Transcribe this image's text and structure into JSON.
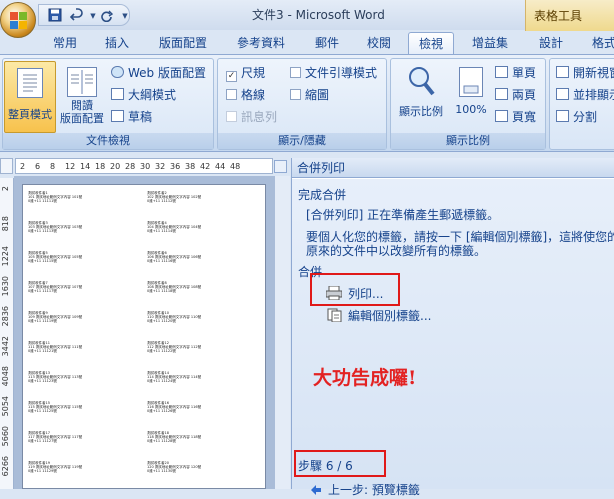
{
  "window": {
    "title": "文件3 - Microsoft Word",
    "context_tab_title": "表格工具"
  },
  "quick_access": {
    "save_icon": "save-icon",
    "undo_icon": "undo-icon",
    "redo_icon": "redo-icon",
    "more": "▼"
  },
  "tabs": [
    {
      "label": "常用",
      "active": false
    },
    {
      "label": "插入",
      "active": false
    },
    {
      "label": "版面配置",
      "active": false
    },
    {
      "label": "參考資料",
      "active": false
    },
    {
      "label": "郵件",
      "active": false
    },
    {
      "label": "校閱",
      "active": false
    },
    {
      "label": "檢視",
      "active": true
    },
    {
      "label": "增益集",
      "active": false
    },
    {
      "label": "設計",
      "active": false
    },
    {
      "label": "格式",
      "active": false
    }
  ],
  "ribbon": {
    "doc_views": {
      "group_label": "文件檢視",
      "print_layout": "整頁模式",
      "reading_layout_1": "閱讀",
      "reading_layout_2": "版面配置",
      "web_layout": "Web 版面配置",
      "outline": "大綱模式",
      "draft": "草稿"
    },
    "show_hide": {
      "group_label": "顯示/隱藏",
      "ruler": "尺規",
      "gridlines": "格線",
      "message_bar": "訊息列",
      "doc_map": "文件引導模式",
      "thumbnails": "縮圖",
      "ruler_checked": "✓"
    },
    "zoom": {
      "group_label": "顯示比例",
      "zoom_button": "顯示比例",
      "hundred": "100%",
      "one_page": "單頁",
      "two_pages": "兩頁",
      "page_width": "頁寬"
    },
    "window_group": {
      "new_window": "開新視窗",
      "arrange_all": "並排顯示",
      "split": "分割"
    }
  },
  "ruler": {
    "h_ticks": [
      "2",
      "6",
      "8",
      "12",
      "14",
      "18",
      "20",
      "28",
      "30",
      "32",
      "36",
      "38",
      "42",
      "44",
      "48"
    ],
    "v_ticks": [
      "2",
      "818",
      "1224",
      "1630",
      "2836",
      "3442",
      "4048",
      "5054",
      "5660",
      "6266"
    ]
  },
  "labels": {
    "col_left": [
      [
        "測試收件者1",
        "101 測試地址範例文字內容 101號",
        "0誰+11 11111號"
      ],
      [
        "測試收件者3",
        "103 測試地址範例文字內容 103號",
        "0誰+11 11113號"
      ],
      [
        "測試收件者5",
        "105 測試地址範例文字內容 105號",
        "0誰+11 11115號"
      ],
      [
        "測試收件者7",
        "107 測試地址範例文字內容 107號",
        "0誰+11 11117號"
      ],
      [
        "測試收件者9",
        "109 測試地址範例文字內容 109號",
        "0誰+11 11119號"
      ],
      [
        "測試收件者11",
        "111 測試地址範例文字內容 111號",
        "0誰+11 11121號"
      ],
      [
        "測試收件者13",
        "113 測試地址範例文字內容 113號",
        "0誰+11 11123號"
      ],
      [
        "測試收件者15",
        "115 測試地址範例文字內容 115號",
        "0誰+11 11125號"
      ],
      [
        "測試收件者17",
        "117 測試地址範例文字內容 117號",
        "0誰+11 11127號"
      ],
      [
        "測試收件者19",
        "119 測試地址範例文字內容 119號",
        "0誰+11 11129號"
      ]
    ],
    "col_right": [
      [
        "測試收件者2",
        "102 測試地址範例文字內容 102號",
        "0誰+11 11112號"
      ],
      [
        "測試收件者4",
        "104 測試地址範例文字內容 104號",
        "0誰+11 11114號"
      ],
      [
        "測試收件者6",
        "106 測試地址範例文字內容 106號",
        "0誰+11 11116號"
      ],
      [
        "測試收件者8",
        "108 測試地址範例文字內容 108號",
        "0誰+11 11118號"
      ],
      [
        "測試收件者10",
        "110 測試地址範例文字內容 110號",
        "0誰+11 11120號"
      ],
      [
        "測試收件者12",
        "112 測試地址範例文字內容 112號",
        "0誰+11 11122號"
      ],
      [
        "測試收件者14",
        "114 測試地址範例文字內容 114號",
        "0誰+11 11124號"
      ],
      [
        "測試收件者16",
        "116 測試地址範例文字內容 116號",
        "0誰+11 11126號"
      ],
      [
        "測試收件者18",
        "118 測試地址範例文字內容 118號",
        "0誰+11 11128號"
      ],
      [
        "測試收件者20",
        "120 測試地址範例文字內容 120號",
        "0誰+11 11130號"
      ]
    ]
  },
  "pane": {
    "title": "合併列印",
    "complete_heading": "完成合併",
    "line1": "[合併列印] 正在準備產生郵遞標籤。",
    "line2": "要個人化您的標籤，請按一下 [編輯個別標籤]，這將使您的",
    "line3": "原來的文件中以改變所有的標籤。",
    "merge_heading": "合併",
    "print_link": "列印...",
    "edit_link": "編輯個別標籤...",
    "annotation": "大功告成囉!",
    "step": "步驟 6 / 6",
    "prev_link": "上一步: 預覽標籤"
  },
  "colors": {
    "accent": "#15428b",
    "highlight": "#e01919",
    "ribbon": "#dbe6f4"
  }
}
